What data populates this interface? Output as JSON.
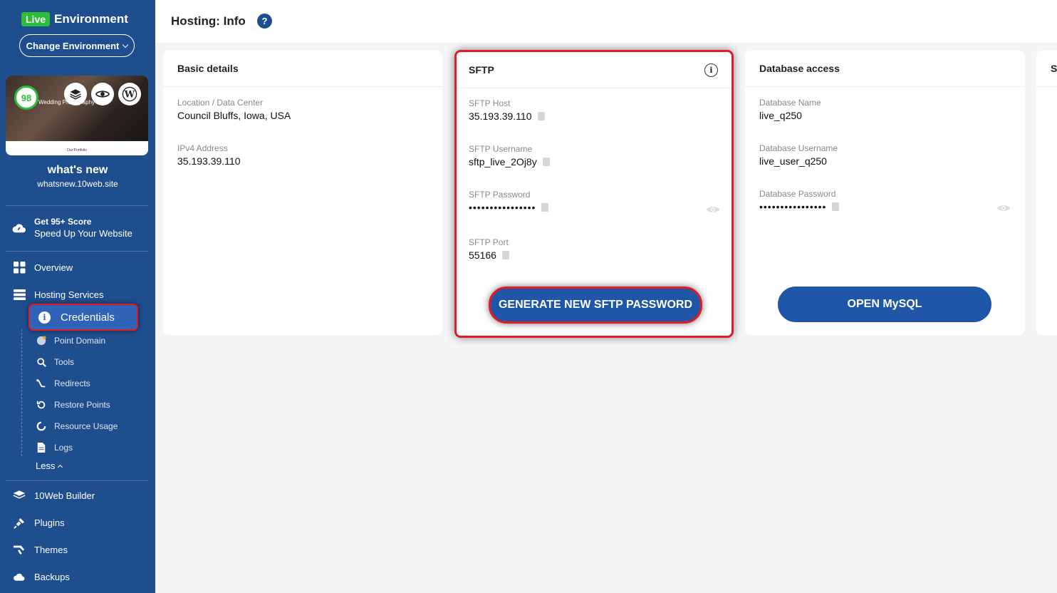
{
  "environment": {
    "badge": "Live",
    "title": "Environment",
    "change_label": "Change Environment"
  },
  "site": {
    "score": "98",
    "thumb_title": "Wedding Photography",
    "thumb_footer": "Our Portfolio",
    "name": "what's new",
    "url": "whatsnew.10web.site"
  },
  "promo": {
    "line1": "Get 95+ Score",
    "line2": "Speed Up Your Website"
  },
  "nav": {
    "overview": "Overview",
    "hosting": "Hosting Services",
    "credentials": "Credentials",
    "sub": [
      "Point Domain",
      "Tools",
      "Redirects",
      "Restore Points",
      "Resource Usage",
      "Logs"
    ],
    "less": "Less",
    "builder": "10Web Builder",
    "plugins": "Plugins",
    "themes": "Themes",
    "backups": "Backups"
  },
  "header": {
    "title": "Hosting: Info",
    "help": "?"
  },
  "basic": {
    "title": "Basic details",
    "location_label": "Location / Data Center",
    "location_value": "Council Bluffs, Iowa, USA",
    "ip_label": "IPv4 Address",
    "ip_value": "35.193.39.110"
  },
  "sftp": {
    "title": "SFTP",
    "host_label": "SFTP Host",
    "host_value": "35.193.39.110",
    "user_label": "SFTP Username",
    "user_value": "sftp_live_2Oj8y",
    "pass_label": "SFTP Password",
    "pass_value": "••••••••••••••••",
    "port_label": "SFTP Port",
    "port_value": "55166",
    "generate_label": "GENERATE NEW SFTP PASSWORD"
  },
  "database": {
    "title": "Database access",
    "name_label": "Database Name",
    "name_value": "live_q250",
    "user_label": "Database Username",
    "user_value": "live_user_q250",
    "pass_label": "Database Password",
    "pass_value": "••••••••••••••••",
    "open_label": "OPEN MySQL"
  },
  "next_card": {
    "title": "S"
  },
  "colors": {
    "sidebar": "#1f4e8f",
    "live_badge": "#2ebd3b",
    "primary_button": "#1f56a8",
    "highlight": "#e01b24"
  }
}
